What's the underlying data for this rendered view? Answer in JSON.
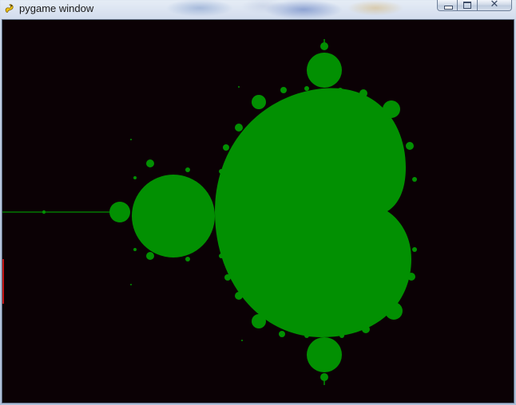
{
  "window": {
    "title": "pygame window",
    "app_icon": "pygame-snake-icon",
    "controls": {
      "minimize_icon": "minimize-icon",
      "maximize_icon": "maximize-icon",
      "close_label": "✕",
      "close_icon": "close-icon"
    }
  },
  "canvas": {
    "content": "mandelbrot-set-fractal",
    "background_color": "#0b0105",
    "fractal_color": "#029002"
  }
}
